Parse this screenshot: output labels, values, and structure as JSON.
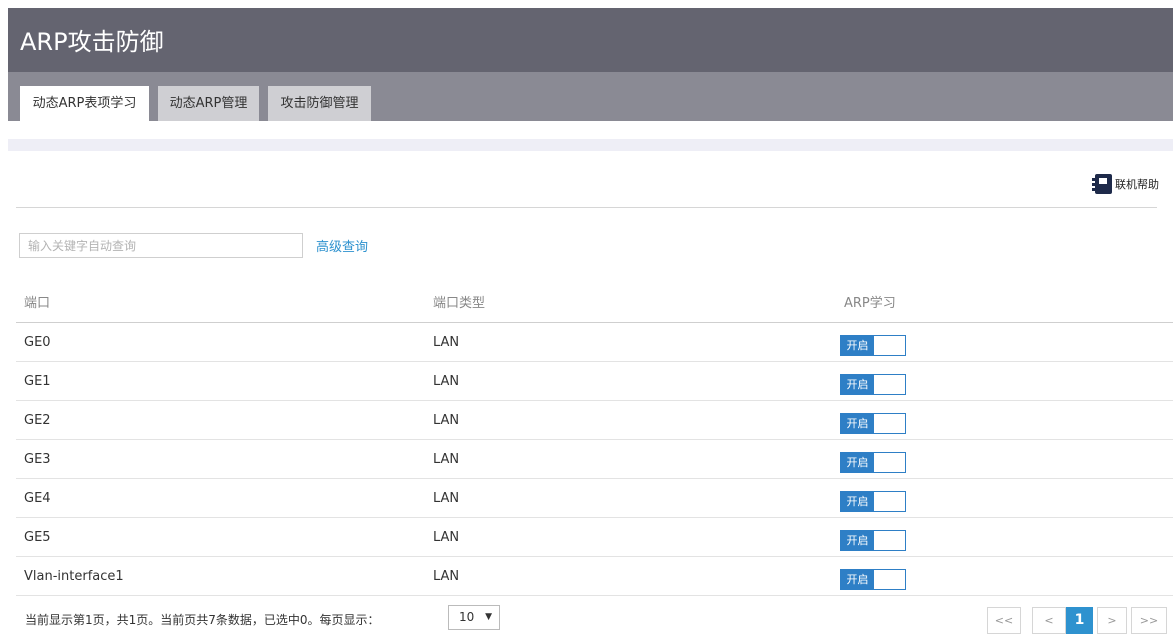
{
  "header": {
    "title": "ARP攻击防御"
  },
  "tabs": [
    {
      "label": "动态ARP表项学习"
    },
    {
      "label": "动态ARP管理"
    },
    {
      "label": "攻击防御管理"
    }
  ],
  "help": {
    "label": "联机帮助",
    "icon": "help-book-icon"
  },
  "search": {
    "placeholder": "输入关键字自动查询",
    "value": "",
    "advanced_label": "高级查询"
  },
  "table": {
    "columns": [
      "端口",
      "端口类型",
      "ARP学习"
    ],
    "rows": [
      {
        "port": "GE0",
        "type": "LAN",
        "arp": "开启"
      },
      {
        "port": "GE1",
        "type": "LAN",
        "arp": "开启"
      },
      {
        "port": "GE2",
        "type": "LAN",
        "arp": "开启"
      },
      {
        "port": "GE3",
        "type": "LAN",
        "arp": "开启"
      },
      {
        "port": "GE4",
        "type": "LAN",
        "arp": "开启"
      },
      {
        "port": "GE5",
        "type": "LAN",
        "arp": "开启"
      },
      {
        "port": "Vlan-interface1",
        "type": "LAN",
        "arp": "开启"
      }
    ]
  },
  "footer": {
    "summary": "当前显示第1页，共1页。当前页共7条数据，已选中0。每页显示：",
    "page_size": "10",
    "pager": {
      "first": "<<",
      "prev": "<",
      "current": "1",
      "next": ">",
      "last": ">>"
    }
  },
  "colors": {
    "header_bg": "#646470",
    "tab_strip_bg": "#8a8a94",
    "accent": "#2e92cf",
    "toggle_on": "#2e7fc6"
  }
}
